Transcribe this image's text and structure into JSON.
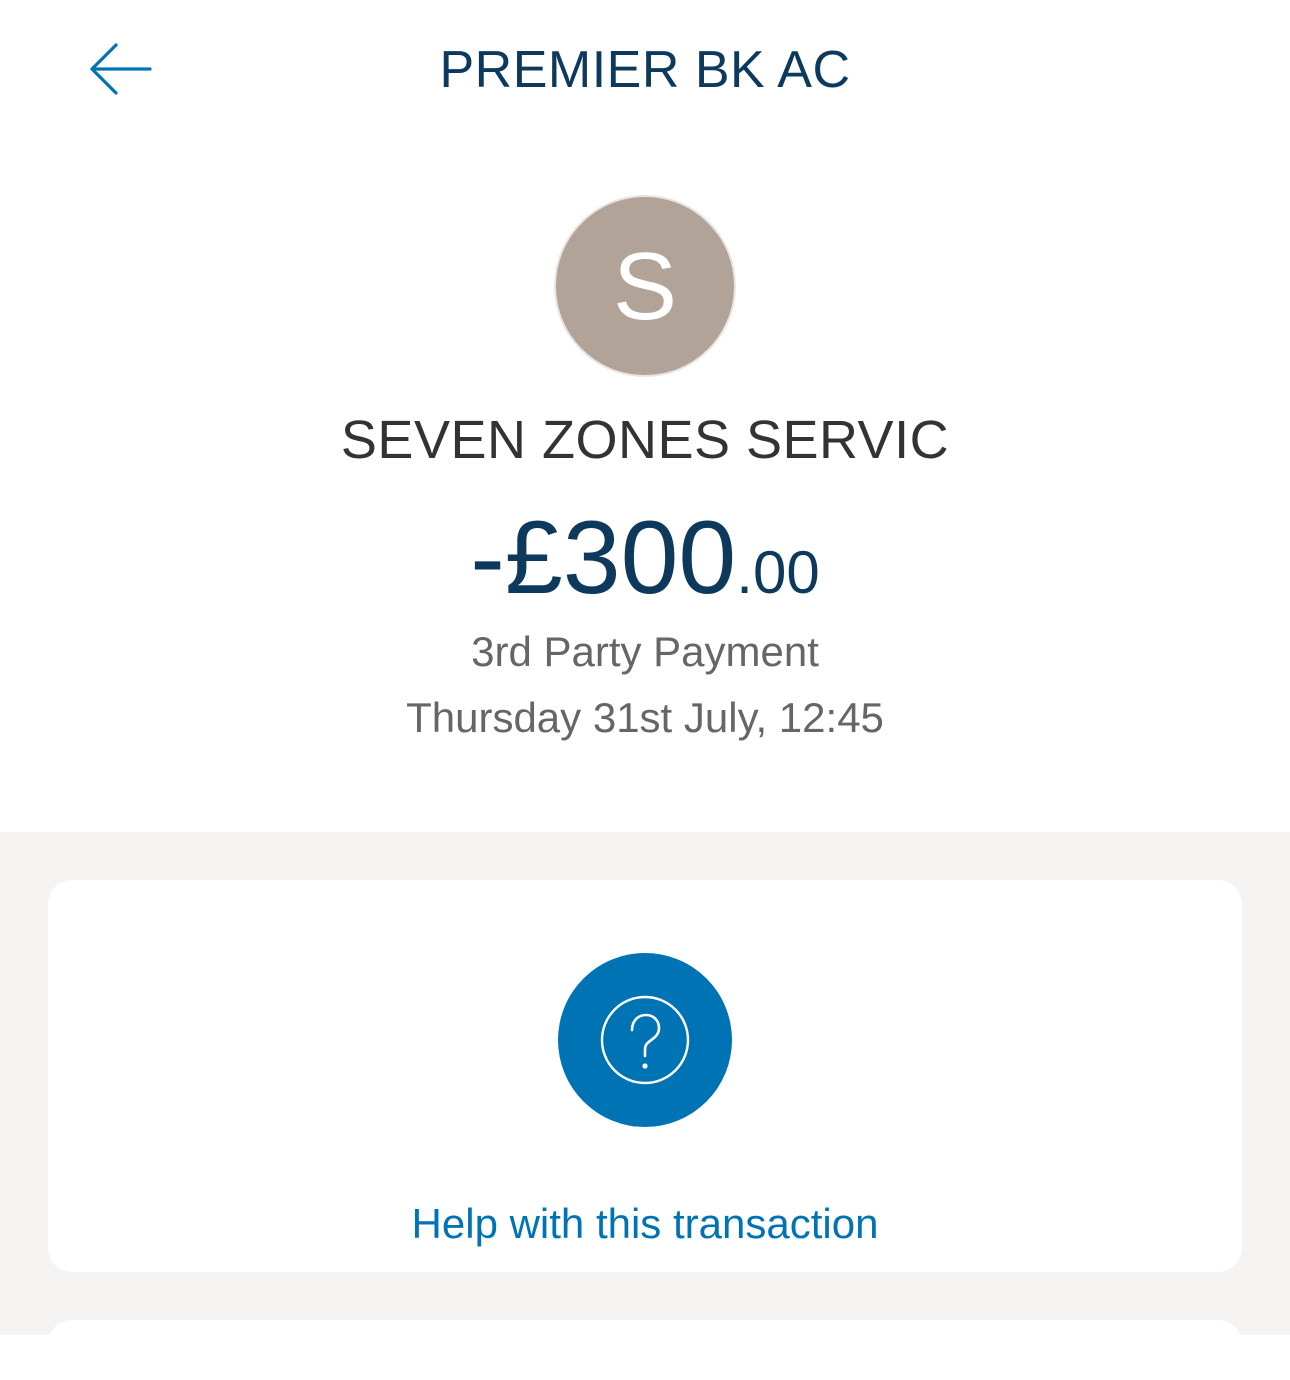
{
  "header": {
    "title": "PREMIER BK AC",
    "back_icon": "arrow-left-icon"
  },
  "transaction": {
    "avatar_letter": "S",
    "merchant": "SEVEN ZONES SERVIC",
    "amount_main": "-£300",
    "amount_pence": ".00",
    "type": "3rd Party Payment",
    "date": "Thursday 31st July, 12:45"
  },
  "help": {
    "icon": "question-circle-icon",
    "label": "Help with this transaction"
  },
  "colors": {
    "primary_blue": "#0073b5",
    "navy": "#0d3a5c",
    "avatar_bg": "#b1a398",
    "grey_bg": "#f4f3f1"
  }
}
